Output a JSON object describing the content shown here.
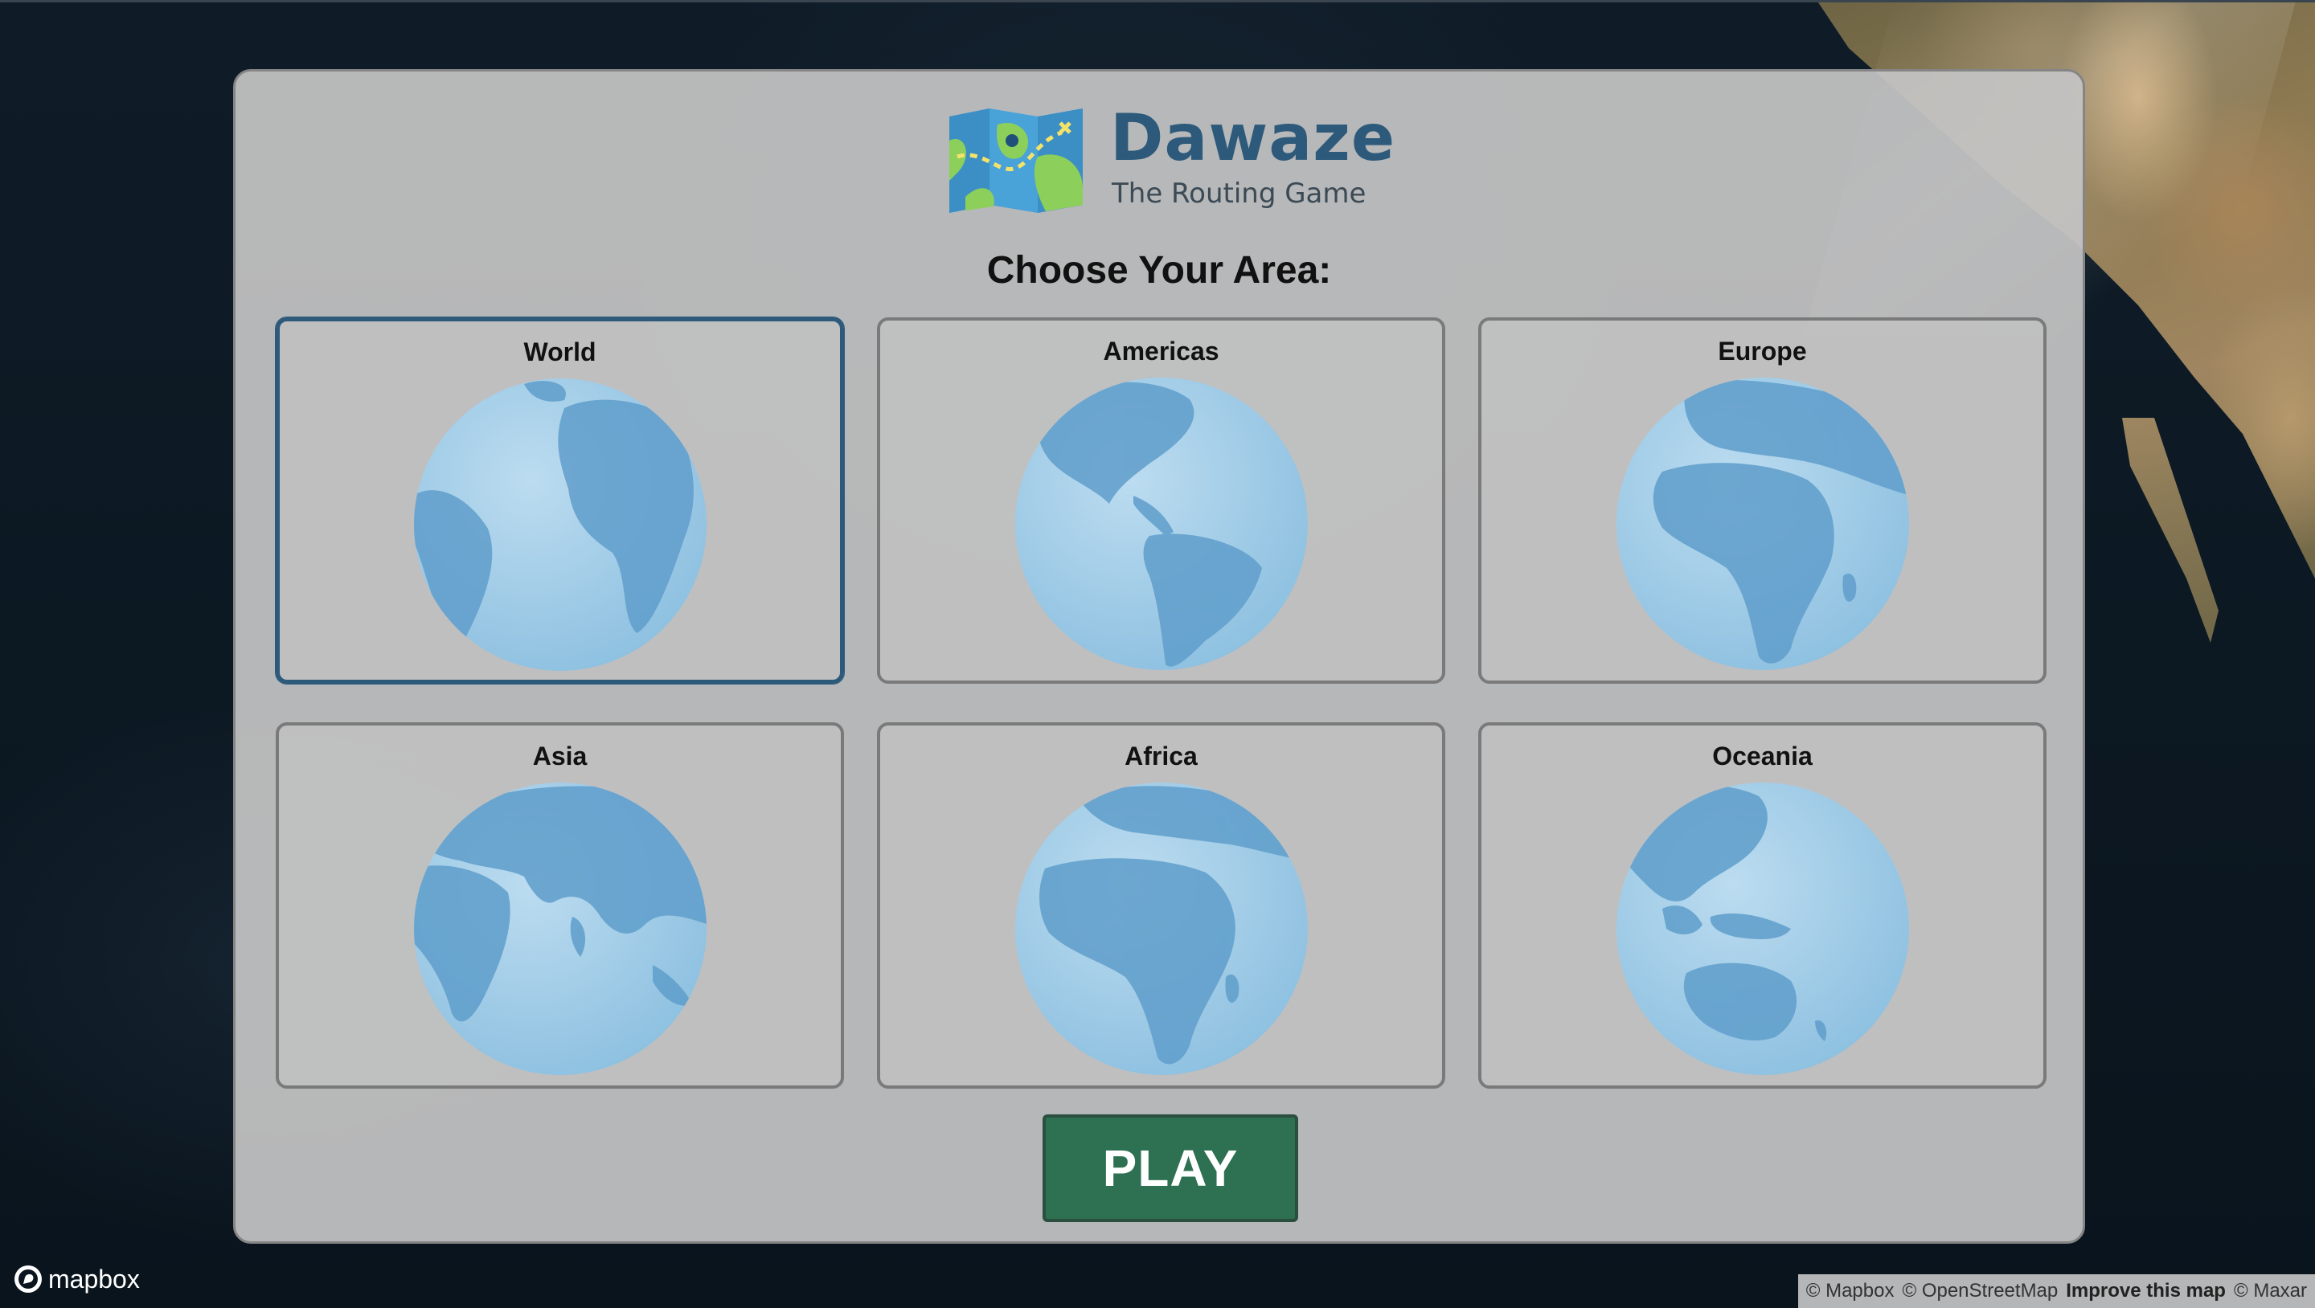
{
  "app": {
    "title": "Dawaze",
    "subtitle": "The Routing Game"
  },
  "heading": "Choose Your Area:",
  "areas": [
    {
      "label": "World",
      "selected": true,
      "globe": "atlantic-view"
    },
    {
      "label": "Americas",
      "selected": false,
      "globe": "americas-view"
    },
    {
      "label": "Europe",
      "selected": false,
      "globe": "europe-africa-view"
    },
    {
      "label": "Asia",
      "selected": false,
      "globe": "asia-view"
    },
    {
      "label": "Africa",
      "selected": false,
      "globe": "africa-view"
    },
    {
      "label": "Oceania",
      "selected": false,
      "globe": "oceania-view"
    }
  ],
  "play_label": "PLAY",
  "mapbox": {
    "logo_text": "mapbox",
    "attribution": {
      "mapbox": "© Mapbox",
      "osm": "© OpenStreetMap",
      "improve": "Improve this map",
      "maxar": "© Maxar"
    }
  },
  "colors": {
    "brand": "#2d5a7b",
    "play_button": "#2e7052",
    "globe_ocean": "#9ccae6",
    "globe_land": "#5b9bc8"
  }
}
